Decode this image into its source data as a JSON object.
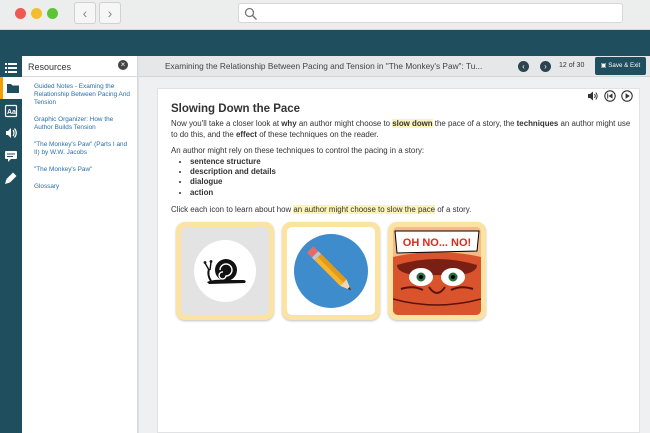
{
  "browser": {
    "back_icon": "chevron-left",
    "forward_icon": "chevron-right",
    "url": ""
  },
  "rail": [
    "list-icon",
    "folder-icon",
    "dictionary-icon",
    "audio-icon",
    "notes-icon",
    "highlighter-icon"
  ],
  "resources": {
    "title": "Resources",
    "items": [
      "Guided Notes - Examing the Relationship Between Pacing And Tension",
      "Graphic Organizer: How the Author Builds Tension",
      "\"The Monkey's Paw\" (Parts I and II) by W.W. Jacobs",
      "\"The Monkey's Paw\"",
      "Glossary"
    ]
  },
  "header": {
    "title": "Examining the Relationship Between Pacing and Tension in \"The Monkey's Paw\": Tu...",
    "page": "12",
    "of_label": "of",
    "total": "30",
    "save_exit": "Save & Exit"
  },
  "lesson": {
    "heading": "Slowing Down the Pace",
    "p1": [
      "Now you'll take a closer look at ",
      "why",
      " an author might choose to ",
      "slow down",
      " the pace of a story, the ",
      "techniques",
      " an author might use to do this, and the ",
      "effect",
      " of these techniques on the reader."
    ],
    "p2": "An author might rely on these techniques to control the pacing in a story:",
    "bullets": [
      "sentence structure",
      "description and details",
      "dialogue",
      "action"
    ],
    "p3_before": "Click each icon to learn about how ",
    "p3_highlight": "an author might choose to slow the pace",
    "p3_after": " of a story.",
    "comic_text": "OH NO... NO!"
  },
  "colors": {
    "brand": "#1f4f5f",
    "accent": "#f4a000",
    "link": "#2a6fa8",
    "tile": "#fce3a2",
    "highlight": "#fcf3b8"
  }
}
